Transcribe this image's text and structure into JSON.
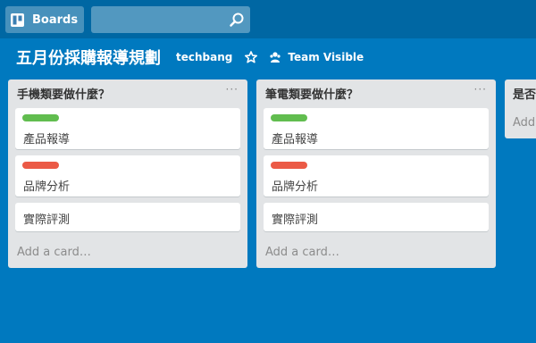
{
  "topbar": {
    "boards_label": "Boards",
    "search_placeholder": ""
  },
  "board": {
    "title": "五月份採購報導規劃",
    "org": "techbang",
    "visibility": "Team Visible"
  },
  "colors": {
    "background": "#0079bf",
    "label_green": "#61bd4f",
    "label_red": "#eb5a46"
  },
  "lists": [
    {
      "title": "手機類要做什麼？",
      "menu": "···",
      "cards": [
        {
          "label": "green",
          "title": "產品報導"
        },
        {
          "label": "red",
          "title": "品牌分析"
        },
        {
          "label": "",
          "title": "實際評測"
        }
      ],
      "add_card": "Add a card…"
    },
    {
      "title": "筆電類要做什麼？",
      "menu": "···",
      "cards": [
        {
          "label": "green",
          "title": "產品報導"
        },
        {
          "label": "red",
          "title": "品牌分析"
        },
        {
          "label": "",
          "title": "實際評測"
        }
      ],
      "add_card": "Add a card…"
    },
    {
      "title": "是否",
      "add_card": "Add"
    }
  ]
}
